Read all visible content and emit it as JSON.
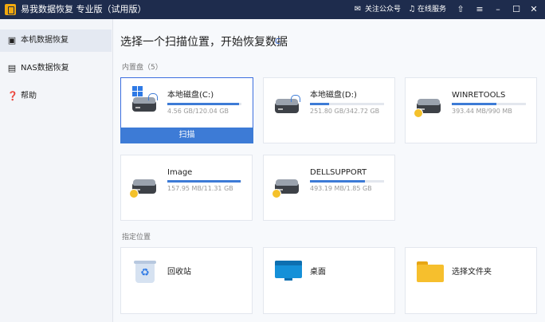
{
  "titlebar": {
    "title": "易我数据恢复 专业版（试用版）",
    "follow_label": "关注公众号",
    "service_label": "在线服务",
    "icons": [
      "follow-icon",
      "service-icon",
      "upload-icon",
      "menu-icon",
      "minimize-icon",
      "maximize-icon",
      "close-icon"
    ]
  },
  "sidebar": {
    "items": [
      {
        "label": "本机数据恢复",
        "icon": "computer-icon",
        "active": true
      },
      {
        "label": "NAS数据恢复",
        "icon": "nas-icon",
        "active": false
      },
      {
        "label": "帮助",
        "icon": "help-icon",
        "active": false
      }
    ]
  },
  "main": {
    "heading": "选择一个扫描位置，开始恢复数据",
    "refresh_glyph": "C",
    "drives_section": "内置盘（5）",
    "scan_label": "扫描",
    "drives": [
      {
        "name": "本地磁盘(C:)",
        "size": "4.56 GB/120.04 GB",
        "used": 0.97
      },
      {
        "name": "本地磁盘(D:)",
        "size": "251.80 GB/342.72 GB",
        "used": 0.26
      },
      {
        "name": "WINRETOOLS",
        "size": "393.44 MB/990 MB",
        "used": 0.6
      },
      {
        "name": "Image",
        "size": "157.95 MB/11.31 GB",
        "used": 0.99
      },
      {
        "name": "DELLSUPPORT",
        "size": "493.19 MB/1.85 GB",
        "used": 0.74
      }
    ],
    "locations_section": "指定位置",
    "locations": [
      {
        "name": "回收站",
        "icon": "recycle-bin-icon"
      },
      {
        "name": "桌面",
        "icon": "desktop-icon"
      },
      {
        "name": "选择文件夹",
        "icon": "folder-icon"
      }
    ]
  },
  "colors": {
    "accent": "#3d7bd6",
    "titlebar": "#1e2c4d"
  }
}
